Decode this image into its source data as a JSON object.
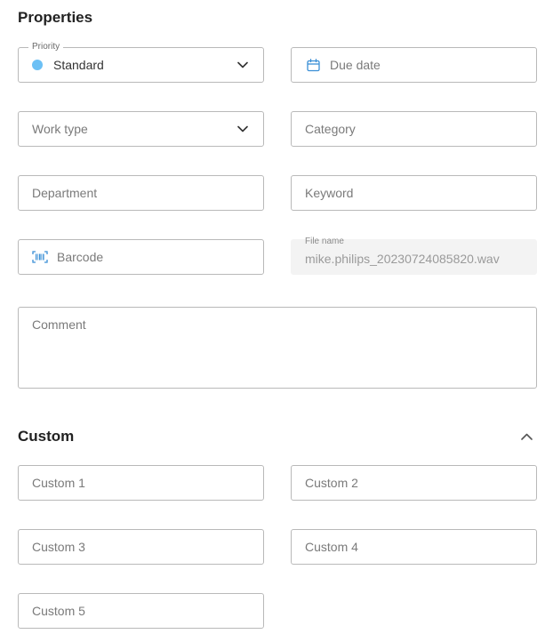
{
  "properties": {
    "title": "Properties",
    "priority": {
      "label": "Priority",
      "value": "Standard",
      "indicator_color": "#6cc0f5"
    },
    "due_date": {
      "placeholder": "Due date"
    },
    "work_type": {
      "placeholder": "Work type"
    },
    "category": {
      "placeholder": "Category"
    },
    "department": {
      "placeholder": "Department"
    },
    "keyword": {
      "placeholder": "Keyword"
    },
    "barcode": {
      "placeholder": "Barcode"
    },
    "file_name": {
      "label": "File name",
      "value": "mike.philips_20230724085820.wav"
    },
    "comment": {
      "placeholder": "Comment"
    }
  },
  "custom": {
    "title": "Custom",
    "fields": [
      {
        "placeholder": "Custom 1"
      },
      {
        "placeholder": "Custom 2"
      },
      {
        "placeholder": "Custom 3"
      },
      {
        "placeholder": "Custom 4"
      },
      {
        "placeholder": "Custom 5"
      }
    ]
  },
  "icons": {
    "dropdown": "chevron-down-icon",
    "collapse": "chevron-up-icon",
    "calendar": "calendar-icon",
    "barcode": "barcode-icon"
  },
  "colors": {
    "accent": "#3a8fd6",
    "border": "#b9b9b9",
    "disabled_bg": "#f3f3f3"
  }
}
